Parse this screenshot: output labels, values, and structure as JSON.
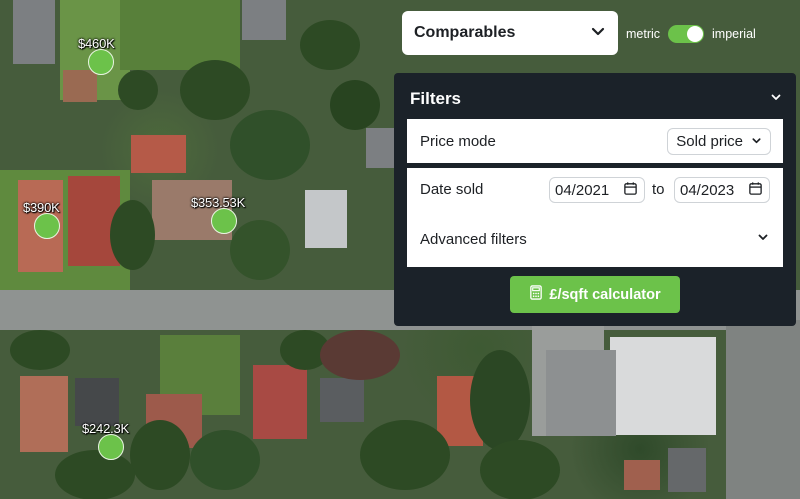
{
  "map": {
    "markers": [
      {
        "price": "$460K"
      },
      {
        "price": "$390K"
      },
      {
        "price": "$353.53K"
      },
      {
        "price": "$242.3K"
      }
    ]
  },
  "mode_select": {
    "value": "Comparables",
    "icon": "chevron-down-icon"
  },
  "units": {
    "left": "metric",
    "right": "imperial",
    "selected": "imperial"
  },
  "filters": {
    "title": "Filters",
    "price_mode": {
      "label": "Price mode",
      "value": "Sold price"
    },
    "date_sold": {
      "label": "Date sold",
      "from": "04/2021",
      "separator": "to",
      "to": "04/2023",
      "icon": "calendar-icon"
    },
    "advanced": {
      "label": "Advanced filters"
    },
    "calculator_button": {
      "label": "£/sqft calculator",
      "icon": "calculator-icon"
    }
  },
  "colors": {
    "accent": "#6cc24a",
    "panel": "#1b2229",
    "text": "#1d2024"
  }
}
